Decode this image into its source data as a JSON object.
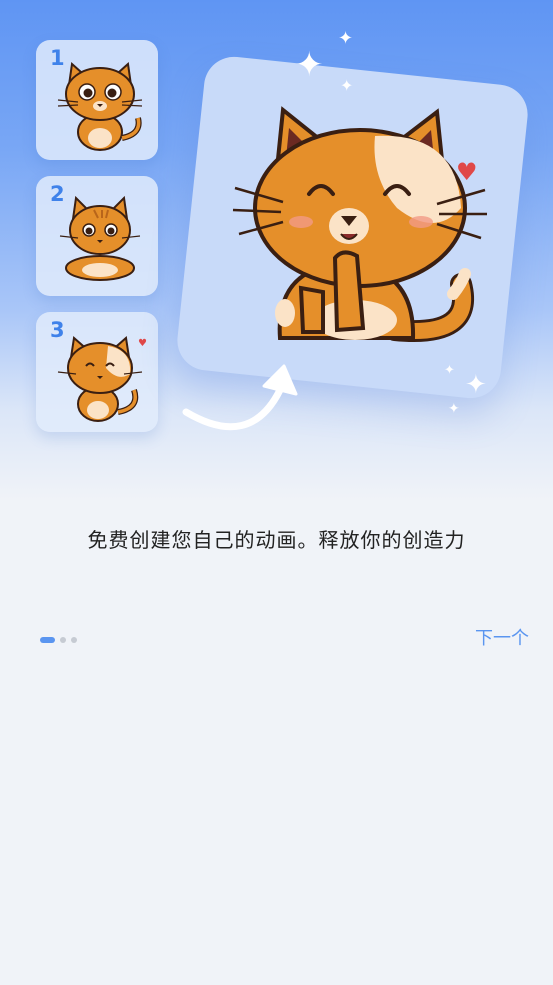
{
  "onboarding": {
    "steps": [
      {
        "number": "1"
      },
      {
        "number": "2"
      },
      {
        "number": "3"
      }
    ],
    "tagline": "免费创建您自己的动画。释放你的创造力",
    "pagination": {
      "total": 3,
      "current": 1
    },
    "next_label": "下一个"
  },
  "colors": {
    "accent": "#5a95f0",
    "cat_orange": "#e58f2a",
    "cat_cream": "#fbe3c7",
    "heart": "#e04848"
  },
  "icons": [
    "cat-illustration",
    "heart-icon",
    "sparkle-icon",
    "curved-arrow-icon"
  ]
}
